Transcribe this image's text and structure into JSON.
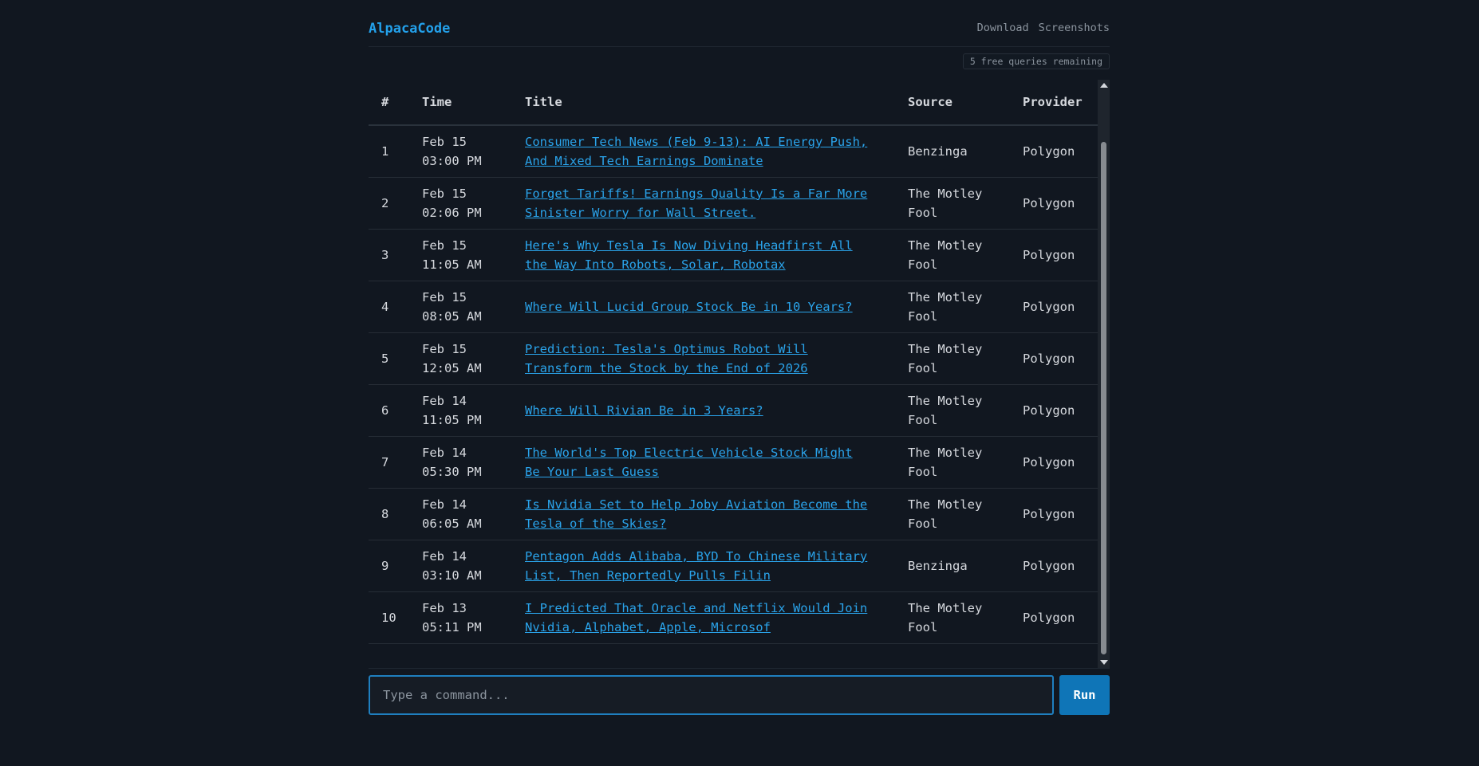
{
  "app": {
    "brand": "AlpacaCode",
    "nav": [
      "Download",
      "Screenshots"
    ],
    "quota": "5 free queries remaining"
  },
  "table": {
    "headers": [
      "#",
      "Time",
      "Title",
      "Source",
      "Provider"
    ],
    "rows": [
      {
        "num": "1",
        "date": "Feb 15",
        "time": "03:00 PM",
        "title_l1": "Consumer Tech News (Feb 9-13): AI Energy Push,",
        "title_l2": "And Mixed Tech Earnings Dominate",
        "source_l1": "Benzinga",
        "source_l2": "",
        "provider": "Polygon"
      },
      {
        "num": "2",
        "date": "Feb 15",
        "time": "02:06 PM",
        "title_l1": "Forget Tariffs! Earnings Quality Is a Far More",
        "title_l2": "Sinister Worry for Wall Street.",
        "source_l1": "The Motley",
        "source_l2": "Fool",
        "provider": "Polygon"
      },
      {
        "num": "3",
        "date": "Feb 15",
        "time": "11:05 AM",
        "title_l1": "Here's Why Tesla Is Now Diving Headfirst All",
        "title_l2": "the Way Into Robots, Solar, Robotax",
        "source_l1": "The Motley",
        "source_l2": "Fool",
        "provider": "Polygon"
      },
      {
        "num": "4",
        "date": "Feb 15",
        "time": "08:05 AM",
        "title_l1": "Where Will Lucid Group Stock Be in 10 Years?",
        "title_l2": "",
        "source_l1": "The Motley",
        "source_l2": "Fool",
        "provider": "Polygon"
      },
      {
        "num": "5",
        "date": "Feb 15",
        "time": "12:05 AM",
        "title_l1": "Prediction: Tesla's Optimus Robot Will",
        "title_l2": "Transform the Stock by the End of 2026",
        "source_l1": "The Motley",
        "source_l2": "Fool",
        "provider": "Polygon"
      },
      {
        "num": "6",
        "date": "Feb 14",
        "time": "11:05 PM",
        "title_l1": "Where Will Rivian Be in 3 Years?",
        "title_l2": "",
        "source_l1": "The Motley",
        "source_l2": "Fool",
        "provider": "Polygon"
      },
      {
        "num": "7",
        "date": "Feb 14",
        "time": "05:30 PM",
        "title_l1": "The World's Top Electric Vehicle Stock Might",
        "title_l2": "Be Your Last Guess",
        "source_l1": "The Motley",
        "source_l2": "Fool",
        "provider": "Polygon"
      },
      {
        "num": "8",
        "date": "Feb 14",
        "time": "06:05 AM",
        "title_l1": "Is Nvidia Set to Help Joby Aviation Become the",
        "title_l2": "Tesla of the Skies?",
        "source_l1": "The Motley",
        "source_l2": "Fool",
        "provider": "Polygon"
      },
      {
        "num": "9",
        "date": "Feb 14",
        "time": "03:10 AM",
        "title_l1": "Pentagon Adds Alibaba, BYD To Chinese Military",
        "title_l2": "List, Then Reportedly Pulls Filin",
        "source_l1": "Benzinga",
        "source_l2": "",
        "provider": "Polygon"
      },
      {
        "num": "10",
        "date": "Feb 13",
        "time": "05:11 PM",
        "title_l1": "I Predicted That Oracle and Netflix Would Join",
        "title_l2": "Nvidia, Alphabet, Apple, Microsof",
        "source_l1": "The Motley",
        "source_l2": "Fool",
        "provider": "Polygon"
      }
    ]
  },
  "command": {
    "placeholder": "Type a command...",
    "value": "",
    "run_label": "Run"
  },
  "colors": {
    "background": "#111720",
    "accent": "#23a0ea",
    "link": "#2aa3ea",
    "run_button": "#0f75b7"
  }
}
